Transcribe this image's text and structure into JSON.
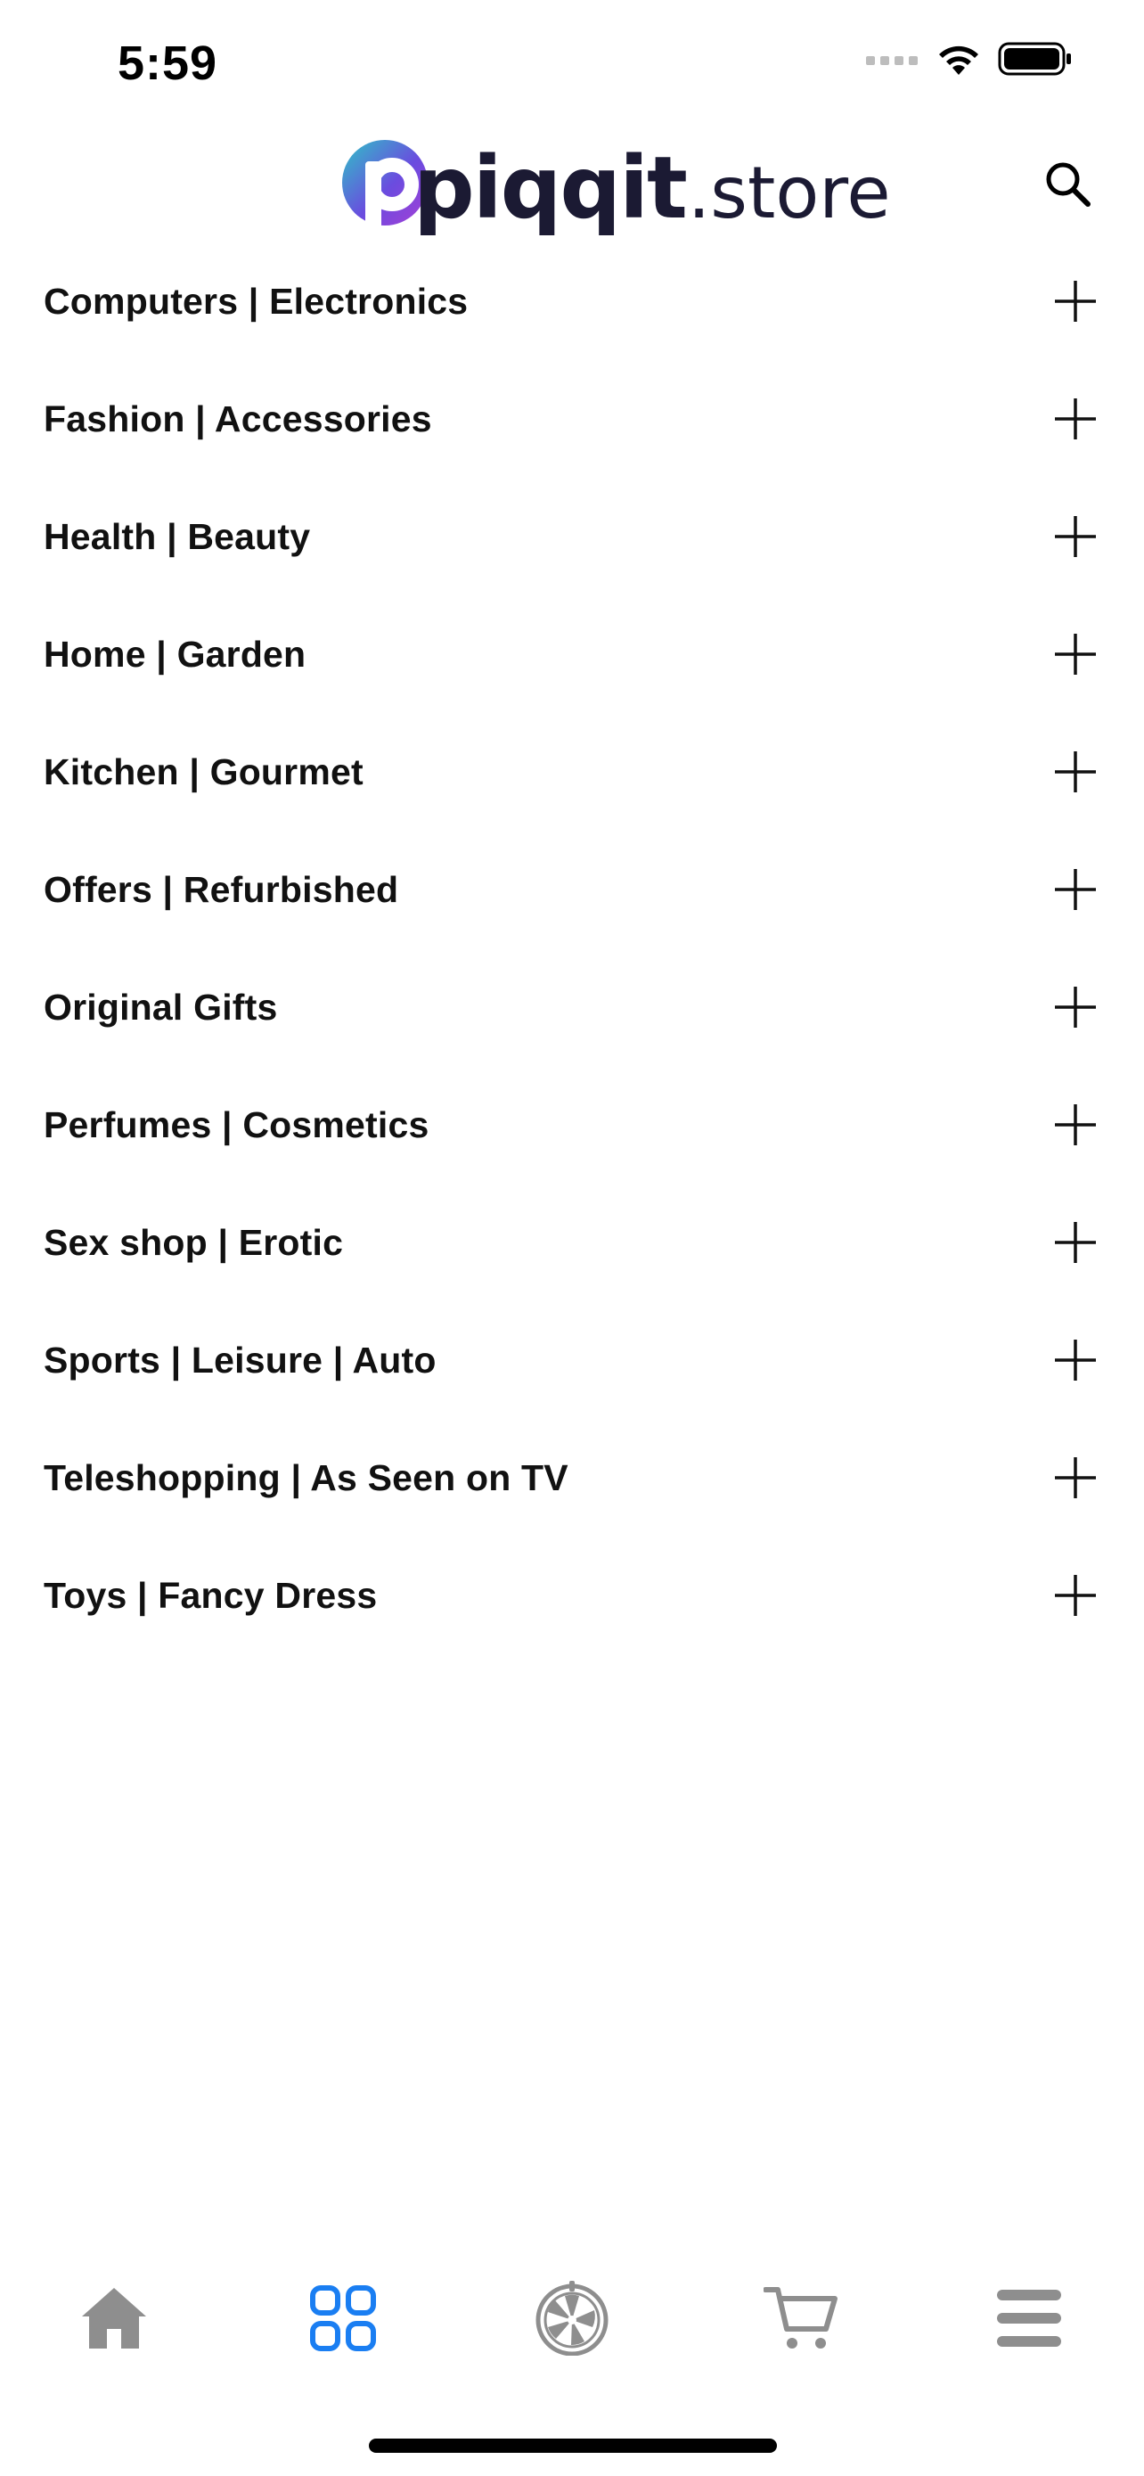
{
  "status_bar": {
    "time": "5:59",
    "icons": [
      "signal-dots-icon",
      "wifi-icon",
      "battery-icon"
    ]
  },
  "header": {
    "logo_main": "piqqit",
    "logo_suffix": ".store",
    "logo_gradient": [
      "#2ec4c6",
      "#6a4cdf",
      "#a53fd6"
    ],
    "search_icon": "search-icon"
  },
  "categories": [
    {
      "label": "Computers | Electronics"
    },
    {
      "label": "Fashion | Accessories"
    },
    {
      "label": "Health | Beauty"
    },
    {
      "label": "Home | Garden"
    },
    {
      "label": "Kitchen | Gourmet"
    },
    {
      "label": "Offers | Refurbished"
    },
    {
      "label": "Original Gifts"
    },
    {
      "label": "Perfumes | Cosmetics"
    },
    {
      "label": "Sex shop | Erotic"
    },
    {
      "label": "Sports | Leisure | Auto"
    },
    {
      "label": "Teleshopping | As Seen on TV"
    },
    {
      "label": "Toys | Fancy Dress"
    }
  ],
  "tab_bar": {
    "items": [
      {
        "icon": "home-icon",
        "active": false
      },
      {
        "icon": "grid-icon",
        "active": true
      },
      {
        "icon": "wheel-icon",
        "active": false
      },
      {
        "icon": "cart-icon",
        "active": false
      },
      {
        "icon": "menu-icon",
        "active": false
      }
    ],
    "active_color": "#1a7ef2",
    "inactive_color": "#8e8e8e"
  }
}
